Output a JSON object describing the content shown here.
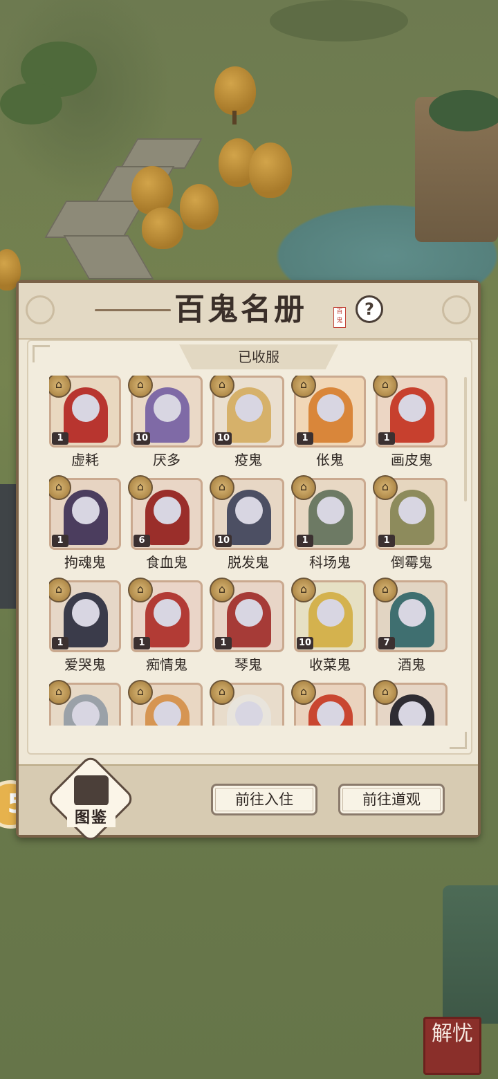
{
  "title": "百鬼名册",
  "title_seal": "百鬼",
  "help_icon": "question-mark-icon",
  "tab_label": "已收服",
  "ghosts": [
    {
      "name": "虚耗",
      "level": "1",
      "bg": "#e9d8c0",
      "color": "#b8352f"
    },
    {
      "name": "厌多",
      "level": "10",
      "bg": "#ead9c7",
      "color": "#7f6aa6"
    },
    {
      "name": "疫鬼",
      "level": "10",
      "bg": "#eadfcf",
      "color": "#d6b16a"
    },
    {
      "name": "伥鬼",
      "level": "1",
      "bg": "#f1d7b7",
      "color": "#d9863a"
    },
    {
      "name": "画皮鬼",
      "level": "1",
      "bg": "#ecd6c4",
      "color": "#c7402e"
    },
    {
      "name": "拘魂鬼",
      "level": "1",
      "bg": "#e7d4c2",
      "color": "#4b3d5e"
    },
    {
      "name": "食血鬼",
      "level": "6",
      "bg": "#e9d6c6",
      "color": "#9a2e2a"
    },
    {
      "name": "脱发鬼",
      "level": "10",
      "bg": "#e7d7c5",
      "color": "#4c4f63"
    },
    {
      "name": "科场鬼",
      "level": "1",
      "bg": "#e8d8c4",
      "color": "#6d7a64"
    },
    {
      "name": "倒霉鬼",
      "level": "1",
      "bg": "#e6d6bf",
      "color": "#8d8b5c"
    },
    {
      "name": "爱哭鬼",
      "level": "1",
      "bg": "#e6d7c7",
      "color": "#3a3b4a"
    },
    {
      "name": "痴情鬼",
      "level": "1",
      "bg": "#ead5c8",
      "color": "#b23b35"
    },
    {
      "name": "琴鬼",
      "level": "1",
      "bg": "#e8d5c7",
      "color": "#a63b37"
    },
    {
      "name": "收菜鬼",
      "level": "10",
      "bg": "#e6e0c4",
      "color": "#d4b24e"
    },
    {
      "name": "酒鬼",
      "level": "7",
      "bg": "#e2d5c3",
      "color": "#3f6f70"
    },
    {
      "name": "",
      "level": "",
      "bg": "#e7d9c6",
      "color": "#9aa1a8"
    },
    {
      "name": "",
      "level": "",
      "bg": "#e9d7c3",
      "color": "#d69552"
    },
    {
      "name": "",
      "level": "",
      "bg": "#e8dccb",
      "color": "#e8e4dc"
    },
    {
      "name": "",
      "level": "",
      "bg": "#ead3be",
      "color": "#c94630"
    },
    {
      "name": "",
      "level": "",
      "bg": "#e6d6c6",
      "color": "#2e2c33"
    }
  ],
  "footer": {
    "atlas_label": "图鉴",
    "move_in_button": "前往入住",
    "temple_button": "前往道观"
  },
  "side_button": "5",
  "corner_stamp": "解忧"
}
